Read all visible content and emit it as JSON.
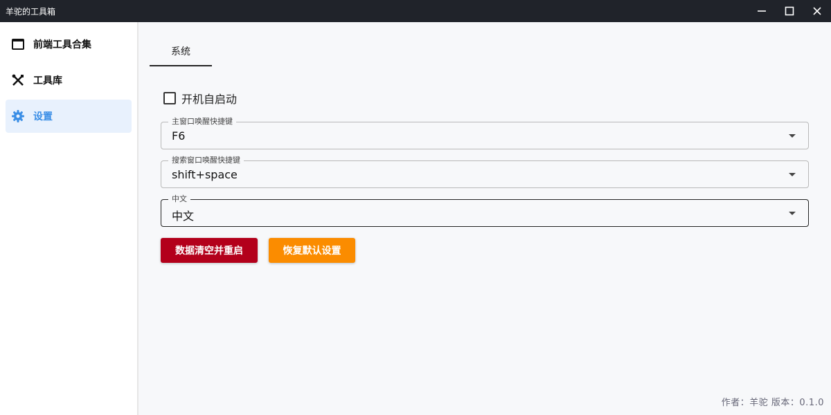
{
  "window": {
    "title": "羊驼的工具箱"
  },
  "sidebar": {
    "items": [
      {
        "label": "前端工具合集",
        "icon": "browser-window-icon",
        "active": false
      },
      {
        "label": "工具库",
        "icon": "tools-icon",
        "active": false
      },
      {
        "label": "设置",
        "icon": "gear-icon",
        "active": true
      }
    ]
  },
  "main": {
    "tabs": [
      {
        "label": "系统",
        "active": true
      }
    ],
    "autostart": {
      "label": "开机自启动",
      "checked": false
    },
    "fields": [
      {
        "legend": "主窗口唤醒快捷键",
        "value": "F6"
      },
      {
        "legend": "搜索窗口唤醒快捷键",
        "value": "shift+space"
      },
      {
        "legend": "中文",
        "value": "中文"
      }
    ],
    "buttons": {
      "clear_restart": "数据清空并重启",
      "restore_default": "恢复默认设置"
    }
  },
  "footer": {
    "text": "作者：羊驼 版本：0.1.0"
  },
  "colors": {
    "accent": "#3a8ee6",
    "danger": "#b3001b",
    "warning": "#fb8c00",
    "titlebar": "#20232a"
  }
}
